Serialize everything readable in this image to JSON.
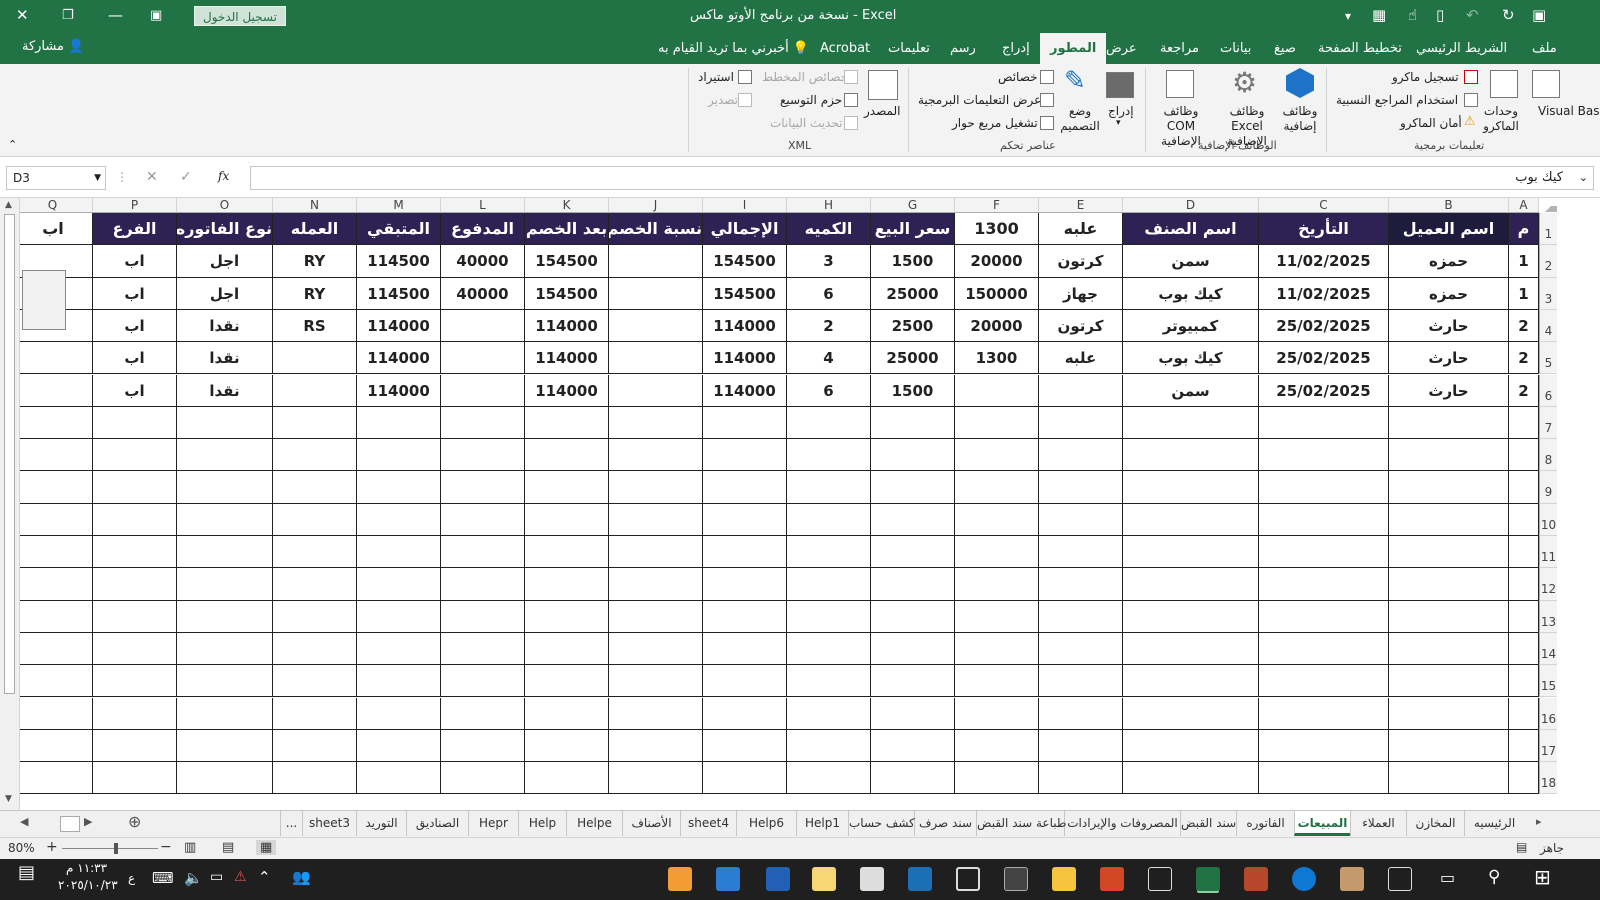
{
  "title_bar": {
    "title": "نسخة من برنامج الأوتو ماكس  -  Excel",
    "signin": "تسجيل الدخول"
  },
  "ribbon_tabs": {
    "file": "ملف",
    "home": "الشريط الرئيسي",
    "insert": "إدراج",
    "draw": "رسم",
    "page_layout": "تخطيط الصفحة",
    "formulas": "صيغ",
    "data": "بيانات",
    "review": "مراجعة",
    "view": "عرض",
    "developer": "المطور",
    "help": "تعليمات",
    "acrobat": "Acrobat",
    "tell_me": "أخبرني بما تريد القيام به",
    "share": "مشاركة"
  },
  "ribbon": {
    "visual_basic": "Visual Basic",
    "macros": "وحدات الماكرو",
    "record_macro": "تسجيل ماكرو",
    "relative_refs": "استخدام المراجع النسبية",
    "macro_security": "أمان الماكرو",
    "group_code": "تعليمات برمجية",
    "addins": "وظائف إضافية",
    "excel_addins": "وظائف Excel الإضافية",
    "com_addins": "وظائف COM الإضافية",
    "group_addins": "الوظائف الإضافية",
    "insert": "إدراج",
    "design_mode": "وضع التصميم",
    "properties": "خصائص",
    "view_code": "عرض التعليمات البرمجية",
    "run_dialog": "تشغيل مربع حوار",
    "group_controls": "عناصر تحكم",
    "source": "المصدر",
    "map_properties": "خصائص المخطط",
    "expansion_packs": "حزم التوسيع",
    "refresh_data": "تحديث البيانات",
    "import": "استيراد",
    "export": "تصدير",
    "group_xml": "XML"
  },
  "formula_bar": {
    "name_box": "D3",
    "fx": "fx",
    "value": "كيك بوب"
  },
  "columns": [
    "A",
    "B",
    "C",
    "D",
    "E",
    "F",
    "G",
    "H",
    "I",
    "J",
    "K",
    "L",
    "M",
    "N",
    "O",
    "P",
    "Q"
  ],
  "rows": [
    "1",
    "2",
    "3",
    "4",
    "5",
    "6",
    "7",
    "8",
    "9",
    "10",
    "11",
    "12",
    "13",
    "14",
    "15",
    "16",
    "17",
    "18"
  ],
  "header_row": {
    "A": "م",
    "B": "اسم العميل",
    "C": "التأريخ",
    "D": "اسم الصنف",
    "E": "علبه",
    "F": "1300",
    "G": "سعر البيع",
    "H": "الكميه",
    "I": "الإجمالي",
    "J": "نسبة الخصم",
    "K": "بعد الخصم",
    "L": "المدفوع",
    "M": "المتبقي",
    "N": "العمله",
    "O": "نوع الفاتوره",
    "P": "الفرع",
    "Q": "اب"
  },
  "data_rows": [
    {
      "A": "1",
      "B": "حمزه",
      "C": "11/02/2025",
      "D": "سمن",
      "E": "كرتون",
      "F": "20000",
      "G": "1500",
      "H": "3",
      "I": "154500",
      "J": "",
      "K": "154500",
      "L": "40000",
      "M": "114500",
      "N": "RY",
      "O": "اجل",
      "P": "اب",
      "Q": ""
    },
    {
      "A": "1",
      "B": "حمزه",
      "C": "11/02/2025",
      "D": "كيك بوب",
      "E": "جهاز",
      "F": "150000",
      "G": "25000",
      "H": "6",
      "I": "154500",
      "J": "",
      "K": "154500",
      "L": "40000",
      "M": "114500",
      "N": "RY",
      "O": "اجل",
      "P": "اب",
      "Q": ""
    },
    {
      "A": "2",
      "B": "حارث",
      "C": "25/02/2025",
      "D": "كمبيوتر",
      "E": "كرتون",
      "F": "20000",
      "G": "2500",
      "H": "2",
      "I": "114000",
      "J": "",
      "K": "114000",
      "L": "",
      "M": "114000",
      "N": "RS",
      "O": "نقدا",
      "P": "اب",
      "Q": ""
    },
    {
      "A": "2",
      "B": "حارث",
      "C": "25/02/2025",
      "D": "كيك بوب",
      "E": "علبه",
      "F": "1300",
      "G": "25000",
      "H": "4",
      "I": "114000",
      "J": "",
      "K": "114000",
      "L": "",
      "M": "114000",
      "N": "",
      "O": "نقدا",
      "P": "اب",
      "Q": ""
    },
    {
      "A": "2",
      "B": "حارث",
      "C": "25/02/2025",
      "D": "سمن",
      "E": "",
      "F": "",
      "G": "1500",
      "H": "6",
      "I": "114000",
      "J": "",
      "K": "114000",
      "L": "",
      "M": "114000",
      "N": "",
      "O": "نقدا",
      "P": "اب",
      "Q": ""
    }
  ],
  "sheet_tabs": [
    "الرئيسيه",
    "المخازن",
    "العملاء",
    "المبيعات",
    "الفاتوره",
    "سند القبض",
    "المصروفات والإيرادات",
    "طباعة سند القبض",
    "سند صرف",
    "كشف حساب",
    "Help1",
    "Help6",
    "sheet4",
    "الأصناف",
    "Helpe",
    "Help",
    "Hepr",
    "الصناديق",
    "التوريد",
    "sheet3",
    "..."
  ],
  "active_sheet": "المبيعات",
  "status": {
    "ready": "جاهز",
    "zoom": "80%"
  },
  "taskbar": {
    "time": "١١:٣٣ م",
    "date": "٢٠٢٥/١٠/٢٣",
    "lang": "ع"
  }
}
